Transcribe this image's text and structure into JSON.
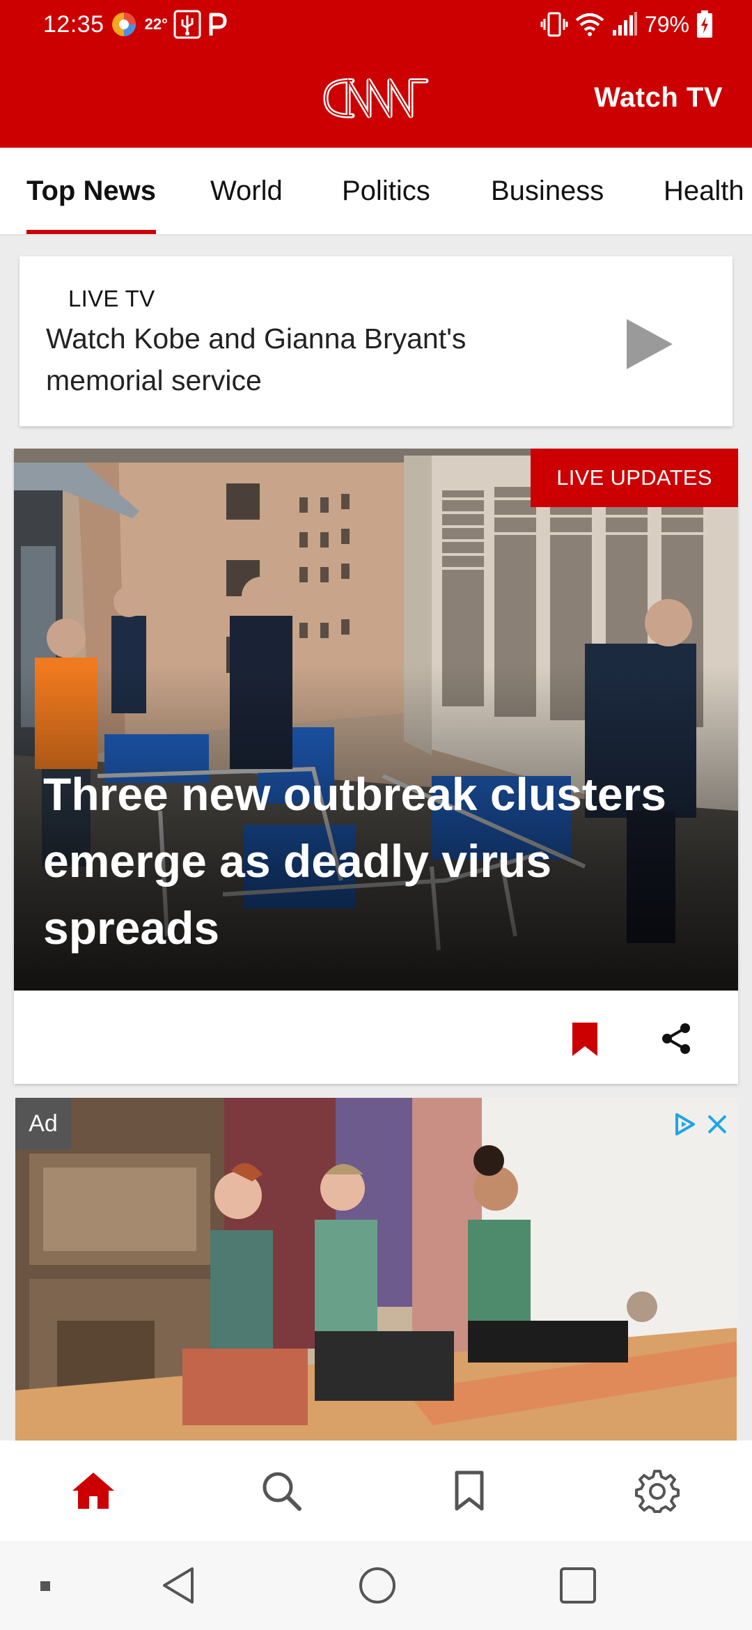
{
  "status_bar": {
    "time": "12:35",
    "temperature": "22°",
    "battery_percent": "79%",
    "icons": [
      "weather-icon",
      "usb-icon",
      "parking-icon",
      "vibrate-icon",
      "wifi-icon",
      "signal-icon",
      "battery-charging-icon"
    ]
  },
  "app_bar": {
    "logo": "CNN",
    "watch_tv_label": "Watch TV",
    "brand_color": "#cc0000"
  },
  "tabs": {
    "active": "Top News",
    "items": [
      {
        "label": "Top News"
      },
      {
        "label": "World"
      },
      {
        "label": "Politics"
      },
      {
        "label": "Business"
      },
      {
        "label": "Health"
      }
    ]
  },
  "live_card": {
    "kicker": "LIVE TV",
    "title": "Watch Kobe and Gianna Bryant's memorial service",
    "action_icon": "play-icon"
  },
  "hero": {
    "badge": "LIVE UPDATES",
    "headline": "Three new outbreak clusters emerge as deadly virus spreads",
    "actions": [
      "bookmark-icon",
      "share-icon"
    ],
    "bookmark_color": "#cc0000"
  },
  "ad": {
    "label": "Ad",
    "icons": [
      "ad-choices-icon",
      "close-icon"
    ]
  },
  "bottom_nav": {
    "active": "home",
    "items": [
      "home-icon",
      "search-icon",
      "bookmarks-icon",
      "settings-icon"
    ]
  },
  "system_nav": {
    "items": [
      "recents-dot-icon",
      "back-icon",
      "home-circle-icon",
      "overview-icon"
    ]
  }
}
